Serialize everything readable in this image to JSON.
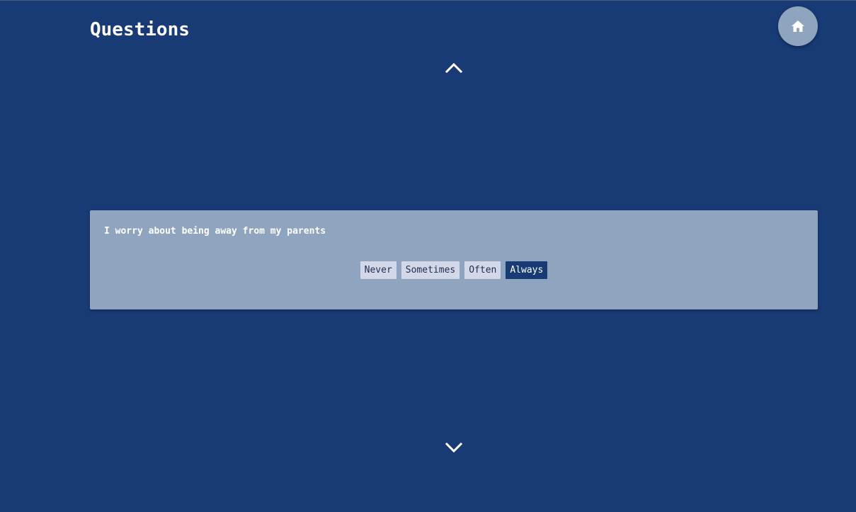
{
  "header": {
    "title": "Questions",
    "home_icon": "home-icon"
  },
  "navigation": {
    "previous_icon": "chevron-up-icon",
    "next_icon": "chevron-down-icon"
  },
  "question": {
    "text": "I worry about being away from my parents",
    "options": [
      {
        "label": "Never",
        "selected": false
      },
      {
        "label": "Sometimes",
        "selected": false
      },
      {
        "label": "Often",
        "selected": false
      },
      {
        "label": "Always",
        "selected": true
      }
    ],
    "selected_value": "Always"
  },
  "colors": {
    "background": "#183a75",
    "card": "#8fa4be",
    "option": "#d3d8e8",
    "option_selected": "#183a75",
    "home_button": "#8fa4be"
  }
}
